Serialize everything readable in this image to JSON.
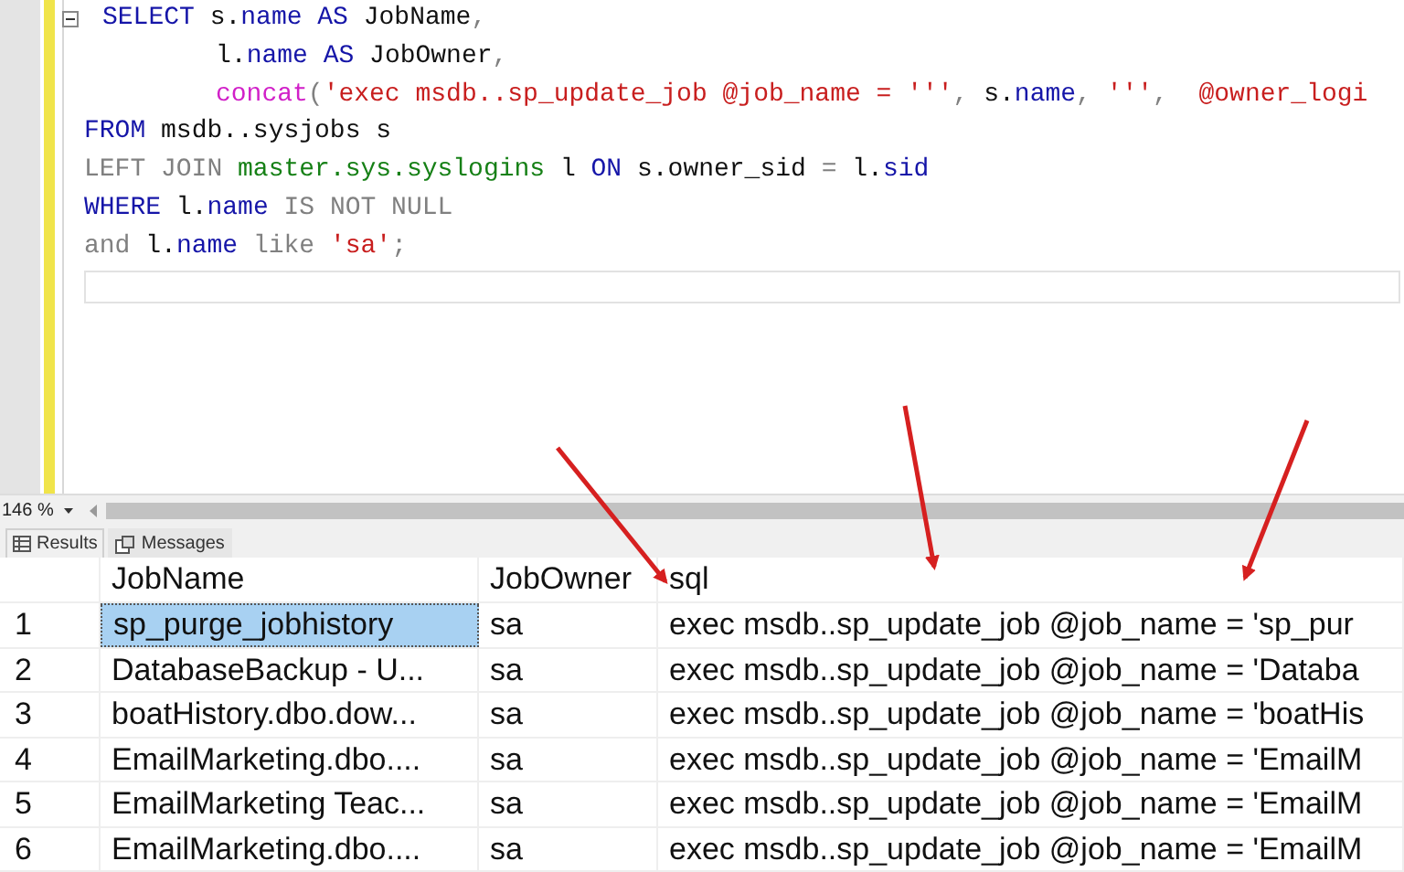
{
  "editor": {
    "lines": [
      {
        "kind": "block_start",
        "tokens": [
          {
            "kind": "keyword",
            "text": "SELECT"
          },
          {
            "kind": "plain",
            "text": " s."
          },
          {
            "kind": "column",
            "text": "name"
          },
          {
            "kind": "keyword",
            "text": " AS"
          },
          {
            "kind": "plain",
            "text": " JobName"
          },
          {
            "kind": "operator",
            "text": ","
          }
        ]
      },
      {
        "kind": "continuation",
        "tokens": [
          {
            "kind": "plain",
            "text": "l."
          },
          {
            "kind": "column",
            "text": "name"
          },
          {
            "kind": "keyword",
            "text": " AS"
          },
          {
            "kind": "plain",
            "text": " JobOwner"
          },
          {
            "kind": "operator",
            "text": ","
          }
        ]
      },
      {
        "kind": "continuation",
        "tokens": [
          {
            "kind": "function",
            "text": "concat"
          },
          {
            "kind": "operator",
            "text": "("
          },
          {
            "kind": "string",
            "text": "'exec msdb..sp_update_job @job_name = '''"
          },
          {
            "kind": "operator",
            "text": ","
          },
          {
            "kind": "plain",
            "text": " s."
          },
          {
            "kind": "column",
            "text": "name"
          },
          {
            "kind": "operator",
            "text": ","
          },
          {
            "kind": "string",
            "text": " '''"
          },
          {
            "kind": "operator",
            "text": ","
          },
          {
            "kind": "string",
            "text": "  @owner_logi"
          }
        ]
      },
      {
        "kind": "statement",
        "tokens": [
          {
            "kind": "keyword",
            "text": "FROM"
          },
          {
            "kind": "plain",
            "text": " msdb..sysjobs s"
          }
        ]
      },
      {
        "kind": "statement",
        "tokens": [
          {
            "kind": "operator",
            "text": "LEFT JOIN"
          },
          {
            "kind": "system",
            "text": " master.sys.syslogins"
          },
          {
            "kind": "plain",
            "text": " l"
          },
          {
            "kind": "keyword",
            "text": " ON"
          },
          {
            "kind": "plain",
            "text": " s.owner_sid"
          },
          {
            "kind": "operator",
            "text": " ="
          },
          {
            "kind": "plain",
            "text": " l."
          },
          {
            "kind": "column",
            "text": "sid"
          }
        ]
      },
      {
        "kind": "statement",
        "tokens": [
          {
            "kind": "keyword",
            "text": "WHERE"
          },
          {
            "kind": "plain",
            "text": " l."
          },
          {
            "kind": "column",
            "text": "name"
          },
          {
            "kind": "operator",
            "text": " IS NOT NULL"
          }
        ]
      },
      {
        "kind": "statement",
        "tokens": [
          {
            "kind": "operator",
            "text": "and"
          },
          {
            "kind": "plain",
            "text": " l."
          },
          {
            "kind": "column",
            "text": "name"
          },
          {
            "kind": "operator",
            "text": " like"
          },
          {
            "kind": "string",
            "text": " 'sa'"
          },
          {
            "kind": "operator",
            "text": ";"
          }
        ]
      }
    ]
  },
  "zoom": "146 %",
  "tabs": [
    {
      "label": "Results",
      "selected": true
    },
    {
      "label": "Messages",
      "selected": false
    }
  ],
  "grid": {
    "columns": [
      "JobName",
      "JobOwner",
      "sql"
    ],
    "rows": [
      {
        "number": "1",
        "cells": [
          {
            "text": "sp_purge_jobhistory",
            "selected": true
          },
          {
            "text": "sa",
            "selected": false
          },
          {
            "text": "exec msdb..sp_update_job @job_name = 'sp_pur",
            "selected": false
          }
        ]
      },
      {
        "number": "2",
        "cells": [
          {
            "text": "DatabaseBackup - U...",
            "selected": false
          },
          {
            "text": "sa",
            "selected": false
          },
          {
            "text": "exec msdb..sp_update_job @job_name = 'Databa",
            "selected": false
          }
        ]
      },
      {
        "number": "3",
        "cells": [
          {
            "text": "boatHistory.dbo.dow...",
            "selected": false
          },
          {
            "text": "sa",
            "selected": false
          },
          {
            "text": "exec msdb..sp_update_job @job_name = 'boatHis",
            "selected": false
          }
        ]
      },
      {
        "number": "4",
        "cells": [
          {
            "text": "EmailMarketing.dbo....",
            "selected": false
          },
          {
            "text": "sa",
            "selected": false
          },
          {
            "text": "exec msdb..sp_update_job @job_name = 'EmailM",
            "selected": false
          }
        ]
      },
      {
        "number": "5",
        "cells": [
          {
            "text": "EmailMarketing Teac...",
            "selected": false
          },
          {
            "text": "sa",
            "selected": false
          },
          {
            "text": "exec msdb..sp_update_job @job_name = 'EmailM",
            "selected": false
          }
        ]
      },
      {
        "number": "6",
        "cells": [
          {
            "text": "EmailMarketing.dbo....",
            "selected": false
          },
          {
            "text": "sa",
            "selected": false
          },
          {
            "text": "exec msdb..sp_update_job @job_name = 'EmailM",
            "selected": false
          }
        ]
      }
    ]
  }
}
